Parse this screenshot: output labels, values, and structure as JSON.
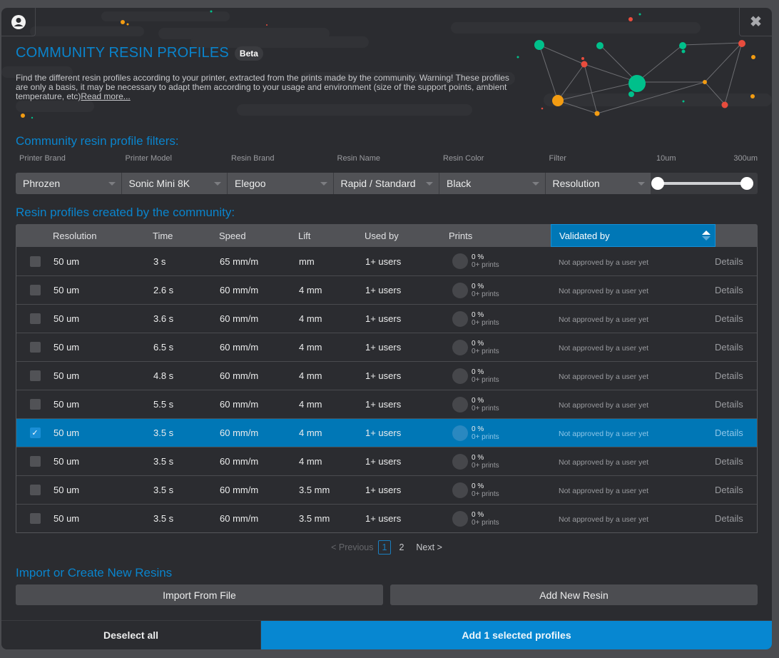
{
  "header": {
    "title": "COMMUNITY RESIN PROFILES",
    "badge": "Beta",
    "description": "Find the different resin profiles according to your printer, extracted from the prints made by the community. Warning! These profiles are only a basis, it may be necessary to adapt them according to your usage and environment (size of the support points, ambient temperature, etc)",
    "read_more": "Read more...",
    "user_icon": "user-circle-icon",
    "close_icon": "close-icon",
    "close_glyph": "✖"
  },
  "filters": {
    "title": "Community resin profile filters:",
    "fields": [
      {
        "label": "Printer Brand",
        "value": "Phrozen"
      },
      {
        "label": "Printer Model",
        "value": "Sonic Mini 8K"
      },
      {
        "label": "Resin Brand",
        "value": "Elegoo"
      },
      {
        "label": "Resin Name",
        "value": "Rapid / Standard"
      },
      {
        "label": "Resin Color",
        "value": "Black"
      },
      {
        "label": "Filter",
        "value": "Resolution"
      }
    ],
    "range": {
      "min_label": "10um",
      "max_label": "300um",
      "min_value": 10,
      "max_value": 300
    }
  },
  "table": {
    "title": "Resin profiles created by the community:",
    "columns": [
      "Resolution",
      "Time",
      "Speed",
      "Lift",
      "Used by",
      "Prints",
      "Validated by"
    ],
    "rows": [
      {
        "selected": false,
        "resolution": "50 um",
        "time": "3 s",
        "speed": "65 mm/m",
        "lift": "mm",
        "used_by": "1+ users",
        "prints_pct": "0 %",
        "prints_count": "0+ prints",
        "validated": "Not approved by a user yet",
        "details": "Details"
      },
      {
        "selected": false,
        "resolution": "50 um",
        "time": "2.6 s",
        "speed": "60 mm/m",
        "lift": "4 mm",
        "used_by": "1+ users",
        "prints_pct": "0 %",
        "prints_count": "0+ prints",
        "validated": "Not approved by a user yet",
        "details": "Details"
      },
      {
        "selected": false,
        "resolution": "50 um",
        "time": "3.6 s",
        "speed": "60 mm/m",
        "lift": "4 mm",
        "used_by": "1+ users",
        "prints_pct": "0 %",
        "prints_count": "0+ prints",
        "validated": "Not approved by a user yet",
        "details": "Details"
      },
      {
        "selected": false,
        "resolution": "50 um",
        "time": "6.5 s",
        "speed": "60 mm/m",
        "lift": "4 mm",
        "used_by": "1+ users",
        "prints_pct": "0 %",
        "prints_count": "0+ prints",
        "validated": "Not approved by a user yet",
        "details": "Details"
      },
      {
        "selected": false,
        "resolution": "50 um",
        "time": "4.8 s",
        "speed": "60 mm/m",
        "lift": "4 mm",
        "used_by": "1+ users",
        "prints_pct": "0 %",
        "prints_count": "0+ prints",
        "validated": "Not approved by a user yet",
        "details": "Details"
      },
      {
        "selected": false,
        "resolution": "50 um",
        "time": "5.5 s",
        "speed": "60 mm/m",
        "lift": "4 mm",
        "used_by": "1+ users",
        "prints_pct": "0 %",
        "prints_count": "0+ prints",
        "validated": "Not approved by a user yet",
        "details": "Details"
      },
      {
        "selected": true,
        "resolution": "50 um",
        "time": "3.5 s",
        "speed": "60 mm/m",
        "lift": "4 mm",
        "used_by": "1+ users",
        "prints_pct": "0 %",
        "prints_count": "0+ prints",
        "validated": "Not approved by a user yet",
        "details": "Details"
      },
      {
        "selected": false,
        "resolution": "50 um",
        "time": "3.5 s",
        "speed": "60 mm/m",
        "lift": "4 mm",
        "used_by": "1+ users",
        "prints_pct": "0 %",
        "prints_count": "0+ prints",
        "validated": "Not approved by a user yet",
        "details": "Details"
      },
      {
        "selected": false,
        "resolution": "50 um",
        "time": "3.5 s",
        "speed": "60 mm/m",
        "lift": "3.5 mm",
        "used_by": "1+ users",
        "prints_pct": "0 %",
        "prints_count": "0+ prints",
        "validated": "Not approved by a user yet",
        "details": "Details"
      },
      {
        "selected": false,
        "resolution": "50 um",
        "time": "3.5 s",
        "speed": "60 mm/m",
        "lift": "3.5 mm",
        "used_by": "1+ users",
        "prints_pct": "0 %",
        "prints_count": "0+ prints",
        "validated": "Not approved by a user yet",
        "details": "Details"
      }
    ],
    "check_glyph": "✓"
  },
  "pagination": {
    "previous": "< Previous",
    "pages": [
      "1",
      "2"
    ],
    "current": "1",
    "next": "Next >"
  },
  "import": {
    "title": "Import or Create New Resins",
    "import_label": "Import From File",
    "add_label": "Add New Resin"
  },
  "footer": {
    "deselect_label": "Deselect all",
    "add_selected_label": "Add 1 selected profiles"
  },
  "colors": {
    "accent": "#0a84cc",
    "selected_row": "#0077b6",
    "primary_button": "#0787d1",
    "green": "#00c08b",
    "red": "#e84c3d",
    "orange": "#f39c12"
  }
}
